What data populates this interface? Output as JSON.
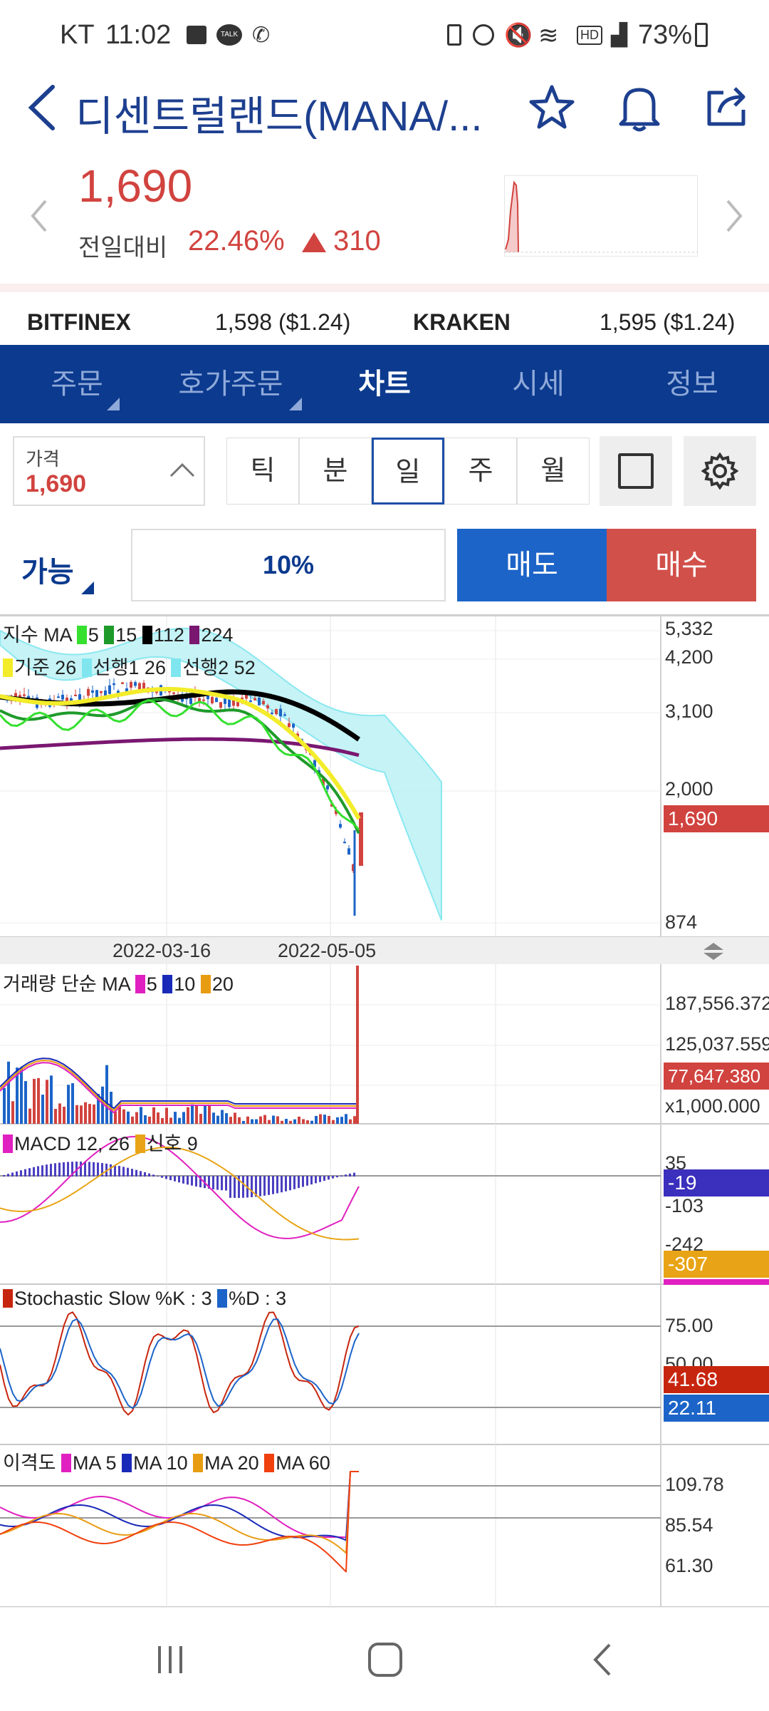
{
  "status_bar": {
    "carrier": "KT",
    "time": "11:02",
    "battery": "73%",
    "icons": [
      "gallery-icon",
      "talk-icon",
      "call-icon",
      "battery-save-icon",
      "alarm-icon",
      "mute-icon",
      "wifi-icon",
      "hd-icon",
      "signal-icon",
      "battery-icon"
    ]
  },
  "header": {
    "title": "디센트럴랜드(MANA/...",
    "back_icon": "back-arrow-icon",
    "star_icon": "star-icon",
    "bell_icon": "bell-icon",
    "share_icon": "share-icon"
  },
  "price": {
    "value": "1,690",
    "change_label": "전일대비",
    "change_pct": "22.46%",
    "change_abs": "310",
    "color": "#d1433f"
  },
  "exchanges": [
    {
      "name": "BITFINEX",
      "value": "1,598 ($1.24)"
    },
    {
      "name": "KRAKEN",
      "value": "1,595 ($1.24)"
    }
  ],
  "tabs": [
    "주문",
    "호가주문",
    "차트",
    "시세",
    "정보"
  ],
  "active_tab": "차트",
  "controls": {
    "price_label": "가격",
    "price_value": "1,690",
    "periods": [
      "틱",
      "분",
      "일",
      "주",
      "월"
    ],
    "active_period": "일",
    "available_label": "가능",
    "percent": "10%",
    "sell_label": "매도",
    "buy_label": "매수"
  },
  "colors": {
    "brand": "#0b3a8e",
    "sell": "#1c64c8",
    "buy": "#d2504a",
    "up": "#d1433f"
  },
  "chart_data": [
    {
      "type": "candlestick",
      "legend": {
        "ma_title": "지수 MA",
        "ma_values": [
          "5",
          "15",
          "112",
          "224"
        ],
        "ichimoku": [
          "기준 26",
          "선행1 26",
          "선행2 52"
        ]
      },
      "ylabels": [
        "5,332",
        "4,200",
        "3,100",
        "2,000",
        "874"
      ],
      "current": "1,690",
      "xlabels": [
        "2022-03-16",
        "2022-05-05"
      ]
    },
    {
      "type": "bar",
      "legend": {
        "title": "거래량 단순 MA",
        "values": [
          "5",
          "10",
          "20"
        ]
      },
      "ylabels": [
        "187,556.372",
        "125,037.559",
        "x1,000.000"
      ],
      "current": "77,647.380"
    },
    {
      "type": "line",
      "legend": {
        "title": "MACD 12, 26",
        "signal": "신호 9"
      },
      "ylabels": [
        "35",
        "-103",
        "-242"
      ],
      "badges": [
        "-19",
        "-307"
      ]
    },
    {
      "type": "line",
      "legend": {
        "title": "Stochastic Slow %K : 3",
        "d": "%D : 3"
      },
      "ylabels": [
        "75.00",
        "50.00"
      ],
      "badges": [
        "41.68",
        "22.11"
      ]
    },
    {
      "type": "line",
      "legend": {
        "title": "이격도",
        "values": [
          "MA 5",
          "MA 10",
          "MA 20",
          "MA 60"
        ]
      },
      "ylabels": [
        "109.78",
        "85.54",
        "61.30"
      ]
    }
  ],
  "nav": {
    "recent_icon": "recent-apps-icon",
    "home_icon": "home-icon",
    "back_icon": "nav-back-icon"
  }
}
